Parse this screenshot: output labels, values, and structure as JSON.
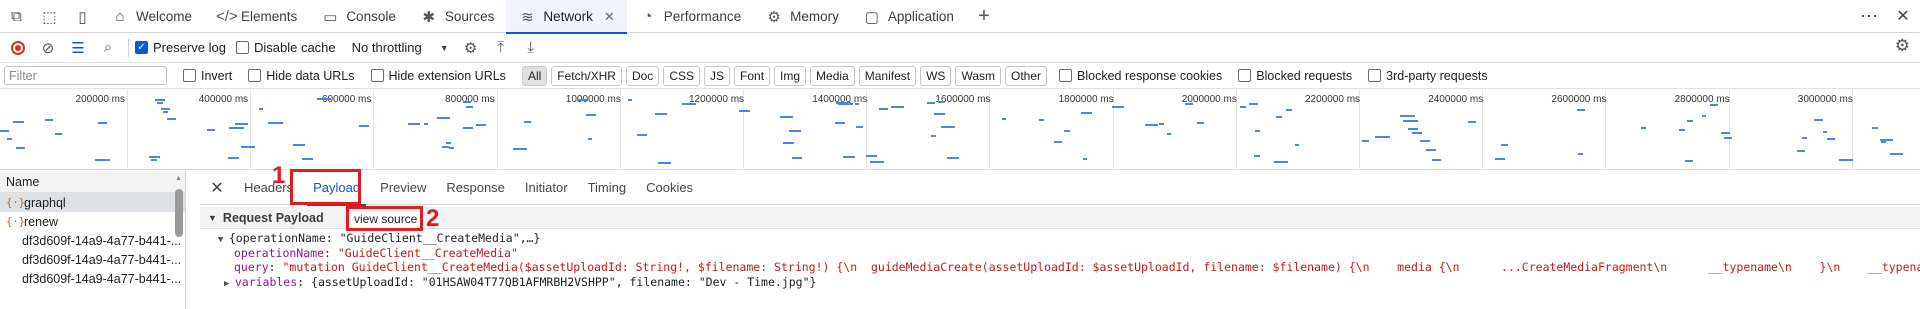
{
  "tabs": [
    {
      "label": "Welcome",
      "icon": "home-icon",
      "glyph": "⌂",
      "active": false
    },
    {
      "label": "Elements",
      "icon": "code-icon",
      "glyph": "</>",
      "active": false
    },
    {
      "label": "Console",
      "icon": "console-icon",
      "glyph": "▭",
      "active": false
    },
    {
      "label": "Sources",
      "icon": "bug-icon",
      "glyph": "✱",
      "active": false
    },
    {
      "label": "Network",
      "icon": "wifi-icon",
      "glyph": "≋",
      "active": true
    },
    {
      "label": "Performance",
      "icon": "performance-icon",
      "glyph": "◔",
      "active": false
    },
    {
      "label": "Memory",
      "icon": "memory-icon",
      "glyph": "⚙",
      "active": false
    },
    {
      "label": "Application",
      "icon": "application-icon",
      "glyph": "▢",
      "active": false
    }
  ],
  "toolbar": {
    "preserve_log": "Preserve log",
    "disable_cache": "Disable cache",
    "throttling": "No throttling"
  },
  "filter": {
    "placeholder": "Filter",
    "invert": "Invert",
    "hide_data_urls": "Hide data URLs",
    "hide_extension_urls": "Hide extension URLs",
    "types": [
      "All",
      "Fetch/XHR",
      "Doc",
      "CSS",
      "JS",
      "Font",
      "Img",
      "Media",
      "Manifest",
      "WS",
      "Wasm",
      "Other"
    ],
    "blocked_cookies": "Blocked response cookies",
    "blocked_requests": "Blocked requests",
    "third_party": "3rd-party requests"
  },
  "overview": {
    "ticks": [
      "200000 ms",
      "400000 ms",
      "600000 ms",
      "800000 ms",
      "1000000 ms",
      "1200000 ms",
      "1400000 ms",
      "1600000 ms",
      "1800000 ms",
      "2000000 ms",
      "2200000 ms",
      "2400000 ms",
      "2600000 ms",
      "2800000 ms",
      "3000000 ms"
    ]
  },
  "requests": {
    "header": "Name",
    "items": [
      {
        "name": "graphql",
        "icon": "{·}",
        "selected": true
      },
      {
        "name": "renew",
        "icon": "{·}",
        "selected": false
      },
      {
        "name": "df3d609f-14a9-4a77-b441-...",
        "icon": "",
        "selected": false
      },
      {
        "name": "df3d609f-14a9-4a77-b441-...",
        "icon": "",
        "selected": false
      },
      {
        "name": "df3d609f-14a9-4a77-b441-...",
        "icon": "",
        "selected": false
      }
    ]
  },
  "detail": {
    "tabs": [
      "Headers",
      "Payload",
      "Preview",
      "Response",
      "Initiator",
      "Timing",
      "Cookies"
    ],
    "payload_header": "Request Payload",
    "view_source": "view source",
    "annotations": {
      "one": "1",
      "two": "2"
    },
    "summary": "{operationName: \"GuideClient__CreateMedia\",…}",
    "operation_key": "operationName",
    "operation_value": "\"GuideClient__CreateMedia\"",
    "query_key": "query",
    "query_value": "\"mutation GuideClient__CreateMedia($assetUploadId: String!, $filename: String!) {\\n  guideMediaCreate(assetUploadId: $assetUploadId, filename: $filename) {\\n    media {\\n      ...CreateMediaFragment\\n      __typename\\n    }\\n    __typename\\n  }\\n}\\n",
    "variables_key": "variables",
    "variables_value": "{assetUploadId: \"01HSAW04T77QB1AFMRBH2VSHPP\", filename: \"Dev - Time.jpg\"}"
  },
  "colors": {
    "accent": "#0b57d0",
    "annotation": "#e01b24",
    "record": "#d93025",
    "bars": "#4a86e8"
  }
}
